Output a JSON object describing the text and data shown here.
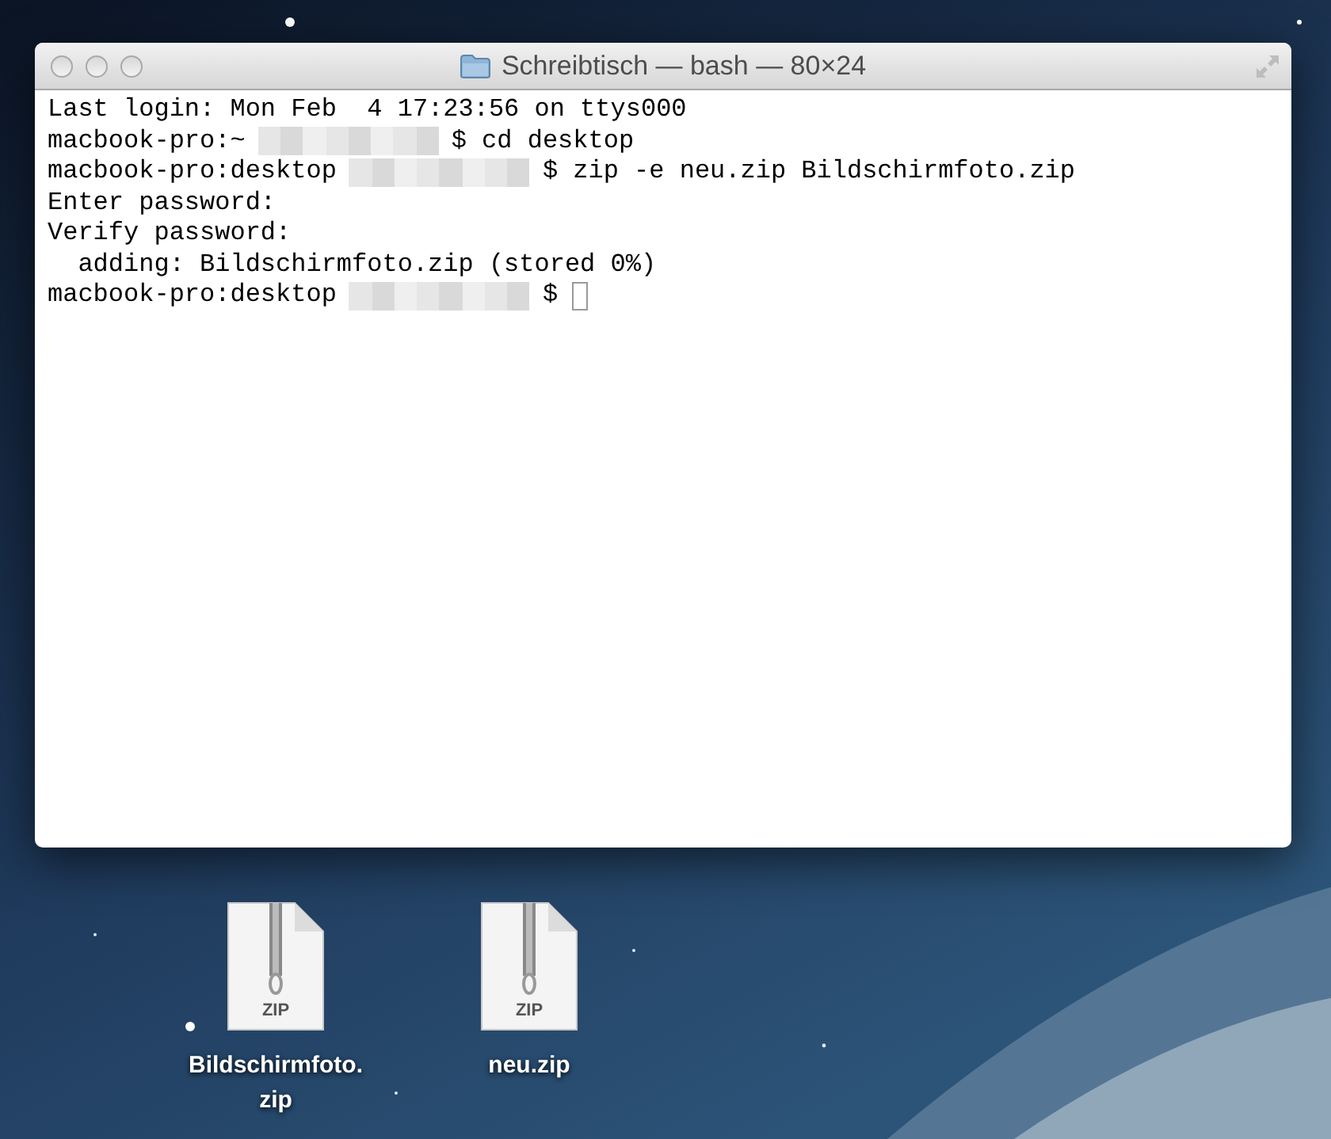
{
  "window": {
    "title": "Schreibtisch — bash — 80×24",
    "active": false
  },
  "terminal": {
    "lines": [
      {
        "text": "Last login: Mon Feb  4 17:23:56 on ttys000",
        "redacted": false,
        "cursor": false
      },
      {
        "text": "macbook-pro:~",
        "redacted": true,
        "rest": "$ cd desktop",
        "cursor": false
      },
      {
        "text": "macbook-pro:desktop",
        "redacted": true,
        "rest": "$ zip -e neu.zip Bildschirmfoto.zip",
        "cursor": false
      },
      {
        "text": "Enter password:",
        "redacted": false,
        "cursor": false
      },
      {
        "text": "Verify password:",
        "redacted": false,
        "cursor": false
      },
      {
        "text": "  adding: Bildschirmfoto.zip (stored 0%)",
        "redacted": false,
        "cursor": false
      },
      {
        "text": "macbook-pro:desktop",
        "redacted": true,
        "rest": "$",
        "cursor": true
      }
    ]
  },
  "desktop_icons": [
    {
      "label": "Bildschirmfoto.zip",
      "badge": "ZIP"
    },
    {
      "label": "neu.zip",
      "badge": "ZIP"
    }
  ]
}
